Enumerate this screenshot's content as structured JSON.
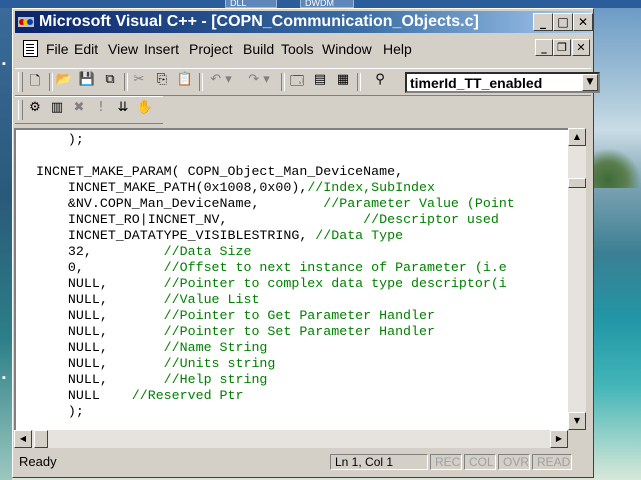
{
  "colors": {
    "title_start": "#0a246a",
    "title_end": "#a6caf0",
    "chrome": "#d4d0c8",
    "comment": "#008000"
  },
  "desktop": {
    "top_tabs": [
      "DLL",
      "DWDM"
    ]
  },
  "window": {
    "title": "Microsoft Visual C++ - [COPN_Communication_Objects.c]"
  },
  "menu": {
    "items": [
      "File",
      "Edit",
      "View",
      "Insert",
      "Project",
      "Build",
      "Tools",
      "Window",
      "Help"
    ]
  },
  "toolbar": {
    "class_combo_value": "timerId_TT_enabled"
  },
  "editor": {
    "lines": [
      {
        "code": "    );",
        "comment": ""
      },
      {
        "code": "",
        "comment": ""
      },
      {
        "code": "INCNET_MAKE_PARAM( COPN_Object_Man_DeviceName,",
        "comment": ""
      },
      {
        "code": "    INCNET_MAKE_PATH(0x1008,0x00),",
        "comment": "//Index,SubIndex"
      },
      {
        "code": "    &NV.COPN_Man_DeviceName,        ",
        "comment": "//Parameter Value (Point"
      },
      {
        "code": "    INCNET_RO|INCNET_NV,                 ",
        "comment": "//Descriptor used"
      },
      {
        "code": "    INCNET_DATATYPE_VISIBLESTRING, ",
        "comment": "//Data Type"
      },
      {
        "code": "    32,         ",
        "comment": "//Data Size"
      },
      {
        "code": "    0,          ",
        "comment": "//Offset to next instance of Parameter (i.e"
      },
      {
        "code": "    NULL,       ",
        "comment": "//Pointer to complex data type descriptor(i"
      },
      {
        "code": "    NULL,       ",
        "comment": "//Value List"
      },
      {
        "code": "    NULL,       ",
        "comment": "//Pointer to Get Parameter Handler"
      },
      {
        "code": "    NULL,       ",
        "comment": "//Pointer to Set Parameter Handler"
      },
      {
        "code": "    NULL,       ",
        "comment": "//Name String"
      },
      {
        "code": "    NULL,       ",
        "comment": "//Units string"
      },
      {
        "code": "    NULL,       ",
        "comment": "//Help string"
      },
      {
        "code": "    NULL    ",
        "comment": "//Reserved Ptr"
      },
      {
        "code": "    );",
        "comment": ""
      }
    ]
  },
  "statusbar": {
    "message": "Ready",
    "position": "Ln 1, Col 1",
    "indicators": [
      "REC",
      "COL",
      "OVR",
      "READ"
    ]
  }
}
